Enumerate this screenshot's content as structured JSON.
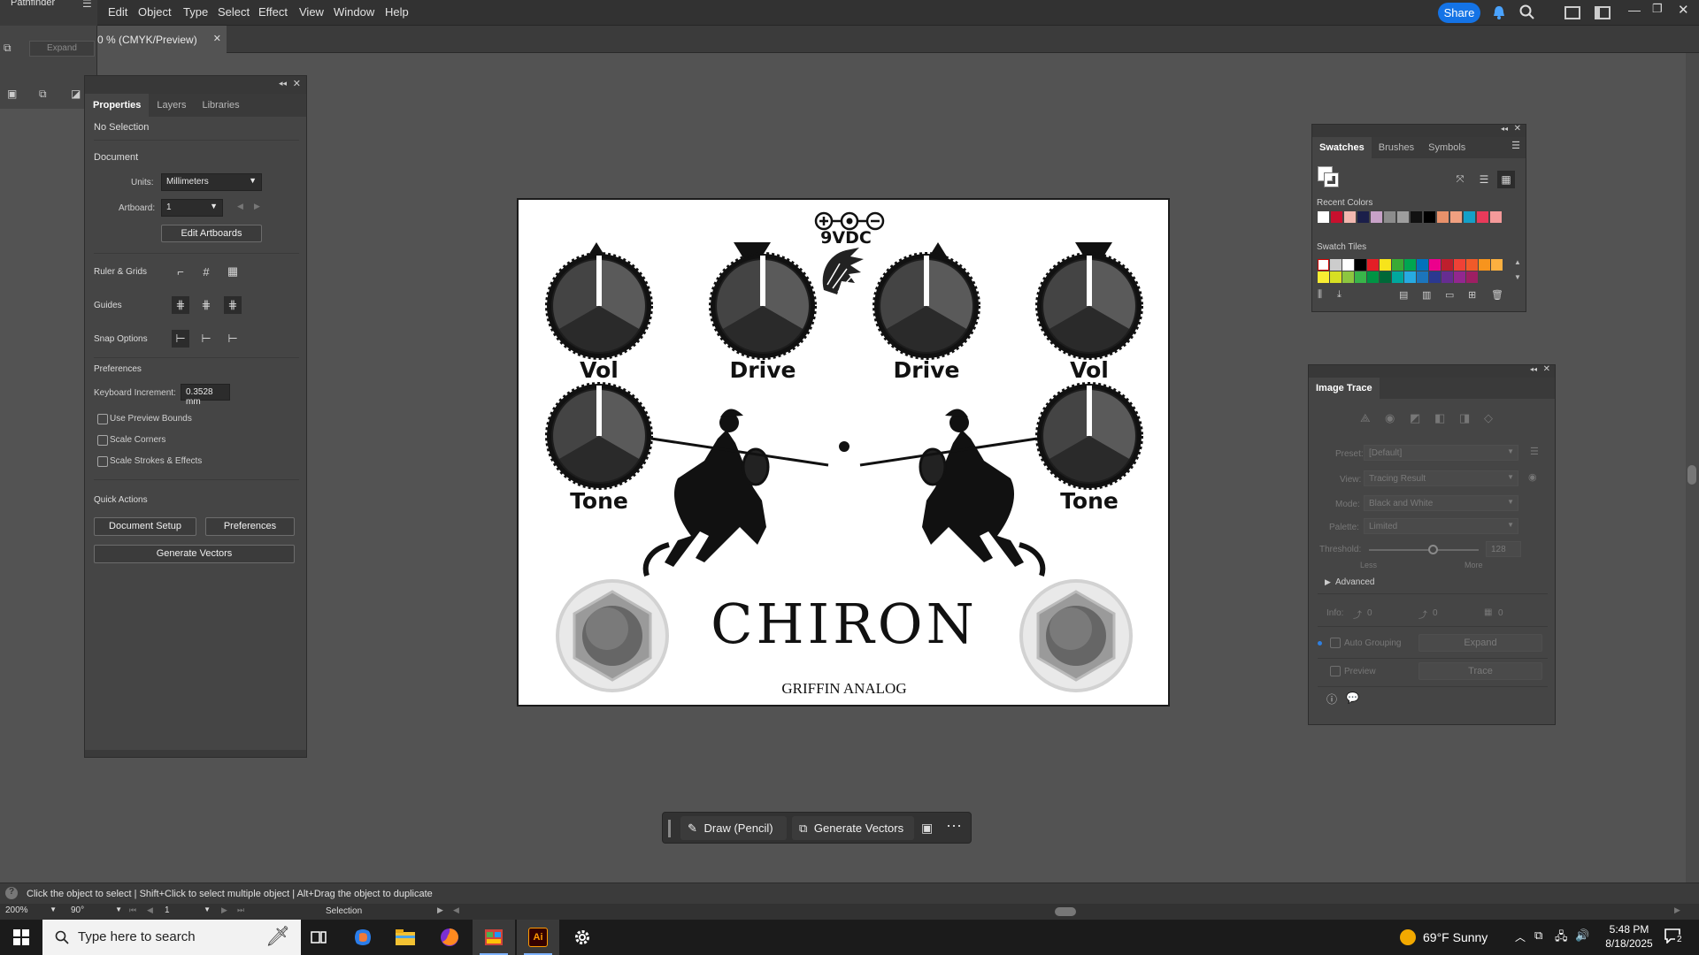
{
  "menu": {
    "pathfinder_label": "Pathfinder",
    "items": [
      "Edit",
      "Object",
      "Type",
      "Select",
      "Effect",
      "View",
      "Window",
      "Help"
    ],
    "share_label": "Share"
  },
  "doc_tab": {
    "title": "0 % (CMYK/Preview)"
  },
  "pathfinder": {
    "expand_label": "Expand"
  },
  "properties": {
    "tabs": [
      "Properties",
      "Layers",
      "Libraries"
    ],
    "no_selection": "No Selection",
    "document": "Document",
    "units_label": "Units:",
    "units_value": "Millimeters",
    "artboard_label": "Artboard:",
    "artboard_value": "1",
    "edit_artboards": "Edit Artboards",
    "ruler_grids": "Ruler & Grids",
    "guides": "Guides",
    "snap_options": "Snap Options",
    "preferences": "Preferences",
    "keyboard_increment_label": "Keyboard Increment:",
    "keyboard_increment_value": "0.3528 mm",
    "use_preview_bounds": "Use Preview Bounds",
    "scale_corners": "Scale Corners",
    "scale_strokes": "Scale Strokes & Effects",
    "quick_actions": "Quick Actions",
    "document_setup": "Document Setup",
    "preferences_btn": "Preferences",
    "generate_vectors": "Generate Vectors"
  },
  "artwork": {
    "power_label": "9VDC",
    "knobs_top": [
      "Vol",
      "Drive",
      "Drive",
      "Vol"
    ],
    "knobs_bottom": [
      "Tone",
      "Tone"
    ],
    "title": "CHIRON",
    "brand": "GRIFFIN ANALOG"
  },
  "swatches": {
    "tabs": [
      "Swatches",
      "Brushes",
      "Symbols"
    ],
    "recent_colors_label": "Recent Colors",
    "recent_colors": [
      "#ffffff",
      "#c8102e",
      "#f2b8b0",
      "#1b1f4a",
      "#c8a2c8",
      "#8c8c8c",
      "#9e9e9e",
      "#111111",
      "#000000",
      "#e8916a",
      "#f0a080",
      "#14a0c8",
      "#e83a5a",
      "#f59a9a"
    ],
    "swatch_tiles_label": "Swatch Tiles",
    "tiles_row1": [
      "#ffffff",
      "#000000",
      "#e41e26",
      "#f7e41b",
      "#3aaa35",
      "#00a651",
      "#0072bc",
      "#ec008c",
      "#be1e2d",
      "#ef4136",
      "#f15a29",
      "#f7941d",
      "#fbb040"
    ],
    "tiles_row2": [
      "#f9ed32",
      "#d7df23",
      "#8dc63f",
      "#39b54a",
      "#009444",
      "#006838",
      "#00a79d",
      "#27aae1",
      "#1c75bc",
      "#2b3990",
      "#662d91",
      "#92278f",
      "#9e1f63"
    ]
  },
  "image_trace": {
    "title": "Image Trace",
    "preset_label": "Preset:",
    "preset_value": "[Default]",
    "view_label": "View:",
    "view_value": "Tracing Result",
    "mode_label": "Mode:",
    "mode_value": "Black and White",
    "palette_label": "Palette:",
    "palette_value": "Limited",
    "threshold_label": "Threshold:",
    "threshold_value": "128",
    "less": "Less",
    "more": "More",
    "advanced": "Advanced",
    "info_label": "Info:",
    "info_values": [
      "0",
      "0",
      "0"
    ],
    "auto_grouping": "Auto Grouping",
    "expand": "Expand",
    "preview": "Preview",
    "trace": "Trace"
  },
  "context_bar": {
    "draw_pencil": "Draw (Pencil)",
    "generate_vectors": "Generate Vectors"
  },
  "statusbar": {
    "hint": "Click the object to select  |  Shift+Click to select multiple object  |  Alt+Drag the object to duplicate",
    "zoom": "200%",
    "rotation": "90°",
    "artboard": "1",
    "tool": "Selection"
  },
  "taskbar": {
    "search_placeholder": "Type here to search",
    "weather": "69°F  Sunny",
    "time": "5:48 PM",
    "date": "8/18/2025",
    "notifications": "2"
  }
}
